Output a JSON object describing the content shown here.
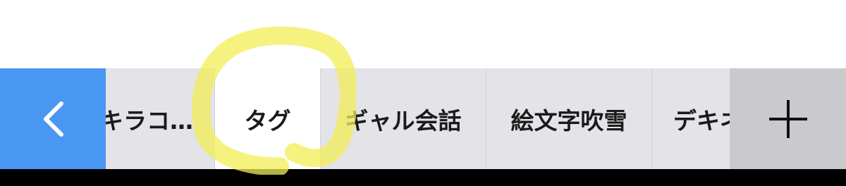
{
  "tabbar": {
    "back_icon": "chevron-left-icon",
    "add_icon": "plus-icon",
    "tabs": [
      {
        "label": "キラコ…"
      },
      {
        "label": "タグ"
      },
      {
        "label": "ギャル会話"
      },
      {
        "label": "絵文字吹雪"
      },
      {
        "label": "デキネ"
      }
    ],
    "selected_index": 1
  },
  "colors": {
    "back_button": "#4a96f3",
    "tabbar_bg": "#e3e3e8",
    "selected_tab": "#ffffff",
    "add_button": "#c9c9ce",
    "highlight_marker": "#f2ee55"
  }
}
